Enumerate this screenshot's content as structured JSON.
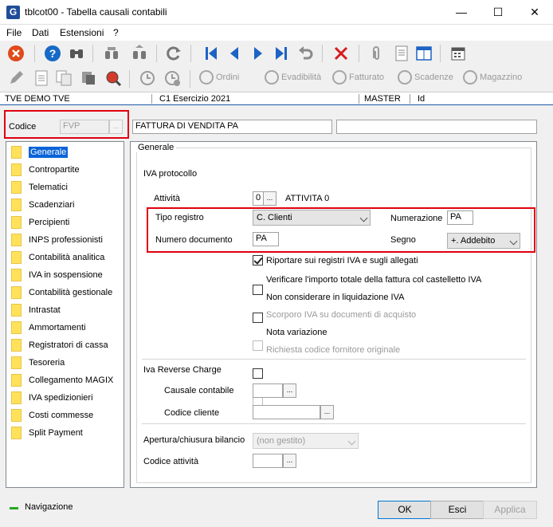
{
  "window": {
    "title": "tblcot00 - Tabella causali contabili",
    "app_icon": "G",
    "minimize": "—",
    "maximize": "☐",
    "close": "✕"
  },
  "menu": [
    {
      "label": "File"
    },
    {
      "label": "Dati"
    },
    {
      "label": "Estensioni"
    },
    {
      "label": "?"
    }
  ],
  "toolbar2": {
    "ordini": "Ordini",
    "evadibilita": "Evadibilità",
    "fatturato": "Fatturato",
    "scadenze": "Scadenze",
    "magazzino": "Magazzino"
  },
  "infostrip": {
    "company": "TVE DEMO TVE",
    "exercise": "C1 Esercizio 2021",
    "user": "MASTER",
    "id": "Id"
  },
  "codice": {
    "label": "Codice",
    "value": "FVP",
    "description": "FATTURA DI VENDITA PA",
    "extra": ""
  },
  "nav": {
    "items": [
      {
        "label": "Generale"
      },
      {
        "label": "Contropartite"
      },
      {
        "label": "Telematici"
      },
      {
        "label": "Scadenziari"
      },
      {
        "label": "Percipienti"
      },
      {
        "label": "INPS professionisti"
      },
      {
        "label": "Contabilità analitica"
      },
      {
        "label": "IVA in sospensione"
      },
      {
        "label": "Contabilità gestionale"
      },
      {
        "label": "Intrastat"
      },
      {
        "label": "Ammortamenti"
      },
      {
        "label": "Registratori di cassa"
      },
      {
        "label": "Tesoreria"
      },
      {
        "label": "Collegamento MAGIX"
      },
      {
        "label": "IVA spedizionieri"
      },
      {
        "label": "Costi commesse"
      },
      {
        "label": "Split Payment"
      }
    ]
  },
  "general": {
    "group_title": "Generale",
    "iva_protocollo": "IVA protocollo",
    "attivita_label": "Attività",
    "attivita_value": "0",
    "attivita_desc": "ATTIVITA 0",
    "tipo_registro_label": "Tipo registro",
    "tipo_registro_value": "C. Clienti",
    "numerazione_label": "Numerazione",
    "numerazione_value": "PA",
    "numero_documento_label": "Numero documento",
    "numero_documento_value": "PA",
    "segno_label": "Segno",
    "segno_value": "+. Addebito",
    "checkboxes": [
      {
        "label": "Riportare sui registri IVA e sugli allegati",
        "checked": true,
        "enabled": true
      },
      {
        "label": "Verificare l'importo totale della fattura col castelletto IVA",
        "checked": false,
        "enabled": true
      },
      {
        "label": "Non considerare in liquidazione IVA",
        "checked": false,
        "enabled": true
      },
      {
        "label": "Scorporo IVA su documenti di acquisto",
        "checked": false,
        "enabled": false
      },
      {
        "label": "Nota variazione",
        "checked": false,
        "enabled": true
      },
      {
        "label": "Richiesta codice fornitore originale",
        "checked": false,
        "enabled": false
      }
    ],
    "reverse_charge_title": "Iva Reverse Charge",
    "causale_label": "Causale contabile",
    "codice_cliente_label": "Codice cliente",
    "apertura_label": "Apertura/chiusura bilancio",
    "apertura_value": "(non gestito)",
    "codice_attivita_label": "Codice attività"
  },
  "bottom": {
    "navigazione": "Navigazione",
    "ok": "OK",
    "esci": "Esci",
    "applica": "Applica"
  },
  "colors": {
    "highlight_box": "#e1000f",
    "selection": "#0a64d8",
    "nav_accent": "#22aa22"
  }
}
